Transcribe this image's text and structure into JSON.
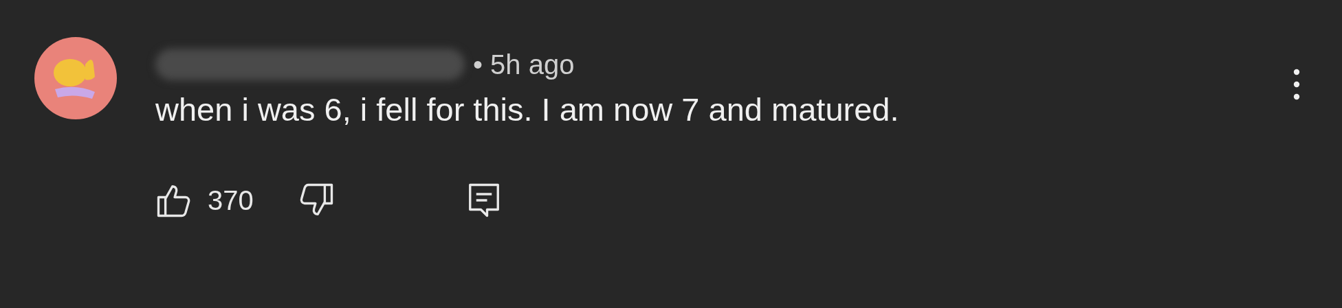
{
  "comment": {
    "separator": "•",
    "time": "5h ago",
    "text": "when i was 6, i fell for this. I am now 7 and matured.",
    "likes": "370"
  }
}
